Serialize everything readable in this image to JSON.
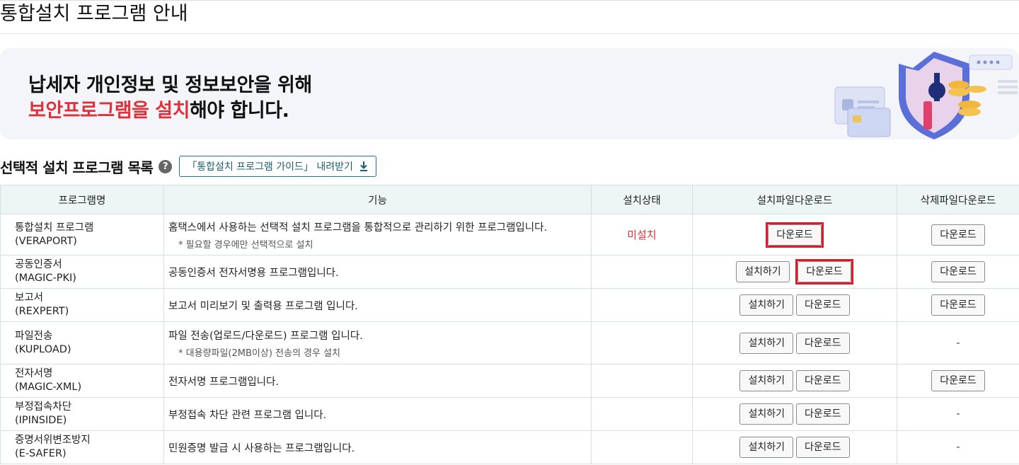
{
  "page_title": "통합설치 프로그램 안내",
  "banner": {
    "line1": "납세자 개인정보 및 정보보안을 위해",
    "line2_highlight": "보안프로그램을 설치",
    "line2_rest": "해야 합니다."
  },
  "section": {
    "title": "선택적 설치 프로그램 목록",
    "help_icon": "?",
    "guide_button": "「통합설치 프로그램 가이드」 내려받기"
  },
  "table": {
    "headers": [
      "프로그램명",
      "기능",
      "설치상태",
      "설치파일다운로드",
      "삭제파일다운로드"
    ],
    "rows": [
      {
        "name": "통합설치 프로그램",
        "code": "(VERAPORT)",
        "func": "홈택스에서 사용하는 선택적 설치 프로그램을 통합적으로 관리하기 위한 프로그램입니다.",
        "note": "* 필요할 경우에만 선택적으로 설치",
        "status": "미설치",
        "install": "",
        "download": "다운로드",
        "delete": "다운로드"
      },
      {
        "name": "공동인증서",
        "code": "(MAGIC-PKI)",
        "func": "공동인증서 전자서명용 프로그램입니다.",
        "note": "",
        "status": "",
        "install": "설치하기",
        "download": "다운로드",
        "delete": "다운로드"
      },
      {
        "name": "보고서",
        "code": "(REXPERT)",
        "func": "보고서 미리보기 및 출력용 프로그램 입니다.",
        "note": "",
        "status": "",
        "install": "설치하기",
        "download": "다운로드",
        "delete": "다운로드"
      },
      {
        "name": "파일전송",
        "code": "(KUPLOAD)",
        "func": "파일 전송(업로드/다운로드) 프로그램 입니다.",
        "note": "* 대용량파일(2MB이상) 전송의 경우 설치",
        "status": "",
        "install": "설치하기",
        "download": "다운로드",
        "delete": "-"
      },
      {
        "name": "전자서명",
        "code": "(MAGIC-XML)",
        "func": "전자서명 프로그램입니다.",
        "note": "",
        "status": "",
        "install": "설치하기",
        "download": "다운로드",
        "delete": "다운로드"
      },
      {
        "name": "부정접속차단",
        "code": "(IPINSIDE)",
        "func": "부정접속 차단 관련 프로그램 입니다.",
        "note": "",
        "status": "",
        "install": "설치하기",
        "download": "다운로드",
        "delete": "-"
      },
      {
        "name": "증명서위변조방지",
        "code": "(E-SAFER)",
        "func": "민원증명 발급 시 사용하는 프로그램입니다.",
        "note": "",
        "status": "",
        "install": "설치하기",
        "download": "다운로드",
        "delete": "-"
      }
    ]
  },
  "colors": {
    "accent_red": "#e0313b",
    "header_bg": "#eef5f5",
    "banner_bg": "#f3f5f9"
  }
}
